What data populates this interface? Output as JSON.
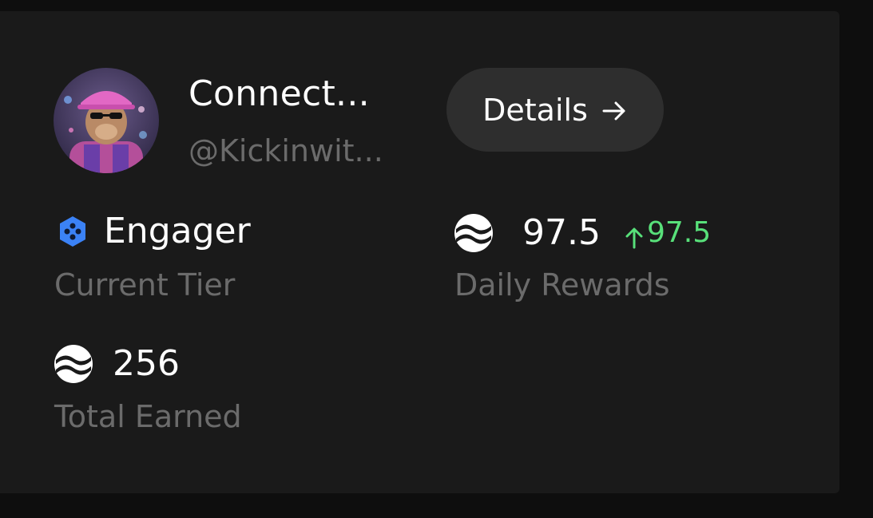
{
  "profile": {
    "name": "Connect...",
    "handle": "@Kickinwit...",
    "details_label": "Details"
  },
  "stats": {
    "tier": {
      "value": "Engager",
      "label": "Current Tier"
    },
    "daily": {
      "value": "97.5",
      "delta": "97.5",
      "label": "Daily Rewards"
    },
    "total": {
      "value": "256",
      "label": "Total Earned"
    }
  },
  "icons": {
    "tier": "hexagon-badge-icon",
    "token": "token-wave-icon",
    "details_arrow": "arrow-right-icon",
    "delta": "arrow-up-icon"
  },
  "colors": {
    "background": "#0e0e0e",
    "card": "#1a1a1a",
    "button": "#2e2e2e",
    "text_primary": "#ffffff",
    "text_secondary": "#6b6b6b",
    "positive": "#58e07a",
    "tier_badge": "#3b82f6"
  }
}
